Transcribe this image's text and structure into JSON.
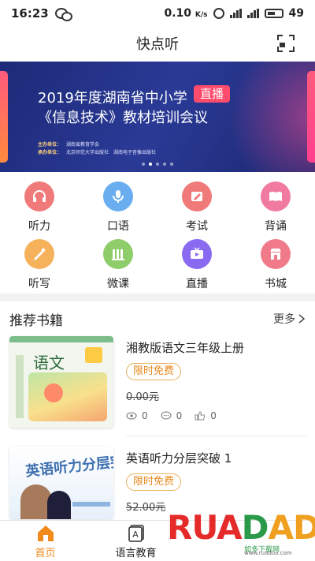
{
  "status_bar": {
    "time": "16:23",
    "network_speed": "0.10",
    "network_unit": "K/s",
    "battery": "49"
  },
  "header": {
    "title": "快点听",
    "right_icon": "scan-icon"
  },
  "banner": {
    "line1": "2019年度湖南省中小学",
    "tag": "直播",
    "line2": "《信息技术》教材培训会议",
    "organizer_label": "主办单位：",
    "organizer": "湖南省教育学会",
    "undertaker_label": "承办单位：",
    "undertaker": "北京师范大学出版社　湖南电子音像出版社",
    "dots": 5,
    "active_dot": 2
  },
  "grid": {
    "items": [
      {
        "label": "听力",
        "icon": "headphones-icon",
        "color": "#f07a7a"
      },
      {
        "label": "口语",
        "icon": "microphone-icon",
        "color": "#6aaef0"
      },
      {
        "label": "考试",
        "icon": "pencil-icon",
        "color": "#f07a7a"
      },
      {
        "label": "背诵",
        "icon": "book-icon",
        "color": "#f07aa0"
      },
      {
        "label": "听写",
        "icon": "dictation-icon",
        "color": "#f5b25a"
      },
      {
        "label": "微课",
        "icon": "microcourse-icon",
        "color": "#8fcc6a"
      },
      {
        "label": "直播",
        "icon": "tv-icon",
        "color": "#8a6af0"
      },
      {
        "label": "书城",
        "icon": "store-icon",
        "color": "#f07a8a"
      }
    ]
  },
  "recommended": {
    "heading": "推荐书籍",
    "more_label": "更多",
    "books": [
      {
        "title": "湘教版语文三年级上册",
        "badge": "限时免费",
        "price": "0.00元",
        "views": "0",
        "comments": "0",
        "likes": "0",
        "cover_title": "语文"
      },
      {
        "title": "英语听力分层突破 1",
        "badge": "限时免费",
        "price": "52.00元",
        "cover_title": "英语听力分层突破"
      }
    ]
  },
  "bottom_nav": {
    "items": [
      {
        "label": "首页",
        "icon": "home-icon",
        "active": true
      },
      {
        "label": "语言教育",
        "icon": "language-icon",
        "active": false
      }
    ],
    "active_color": "#f18a1a"
  },
  "watermark": {
    "text_part1": "RUA",
    "text_part2": "D",
    "text_part3": "ADO",
    "sub": "如多下载网",
    "url": "www.ruaduo.com"
  }
}
